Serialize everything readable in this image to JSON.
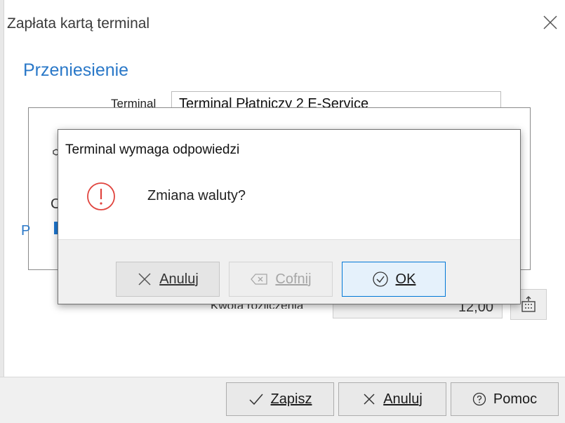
{
  "window": {
    "title": "Zapłata kartą terminal",
    "section_title": "Przeniesienie",
    "terminal_label": "Terminal",
    "terminal_value": "Terminal Płatniczy 2 E-Service",
    "amount_label": "Kwota rozliczenia",
    "amount_value": "12,00",
    "stub_left_c": "C",
    "stub_left_p": "P",
    "footer": {
      "save_label": "Zapisz",
      "cancel_label": "Anuluj",
      "help_label": "Pomoc"
    }
  },
  "dialog": {
    "title": "Terminal wymaga odpowiedzi",
    "message": "Zmiana waluty?",
    "cancel_label": "Anuluj",
    "back_label": "Cofnij",
    "ok_label": "OK"
  },
  "colors": {
    "accent": "#2a78c8",
    "error_icon": "#e0443e",
    "focus_border": "#0078d7"
  },
  "icons": {
    "close": "close-icon",
    "error": "error-icon",
    "x": "x-icon",
    "backspace": "backspace-icon",
    "check_circle": "check-circle-icon",
    "check": "check-icon",
    "help": "help-icon",
    "calculator": "calculator-icon",
    "dropdown": "chevron-down-icon"
  }
}
